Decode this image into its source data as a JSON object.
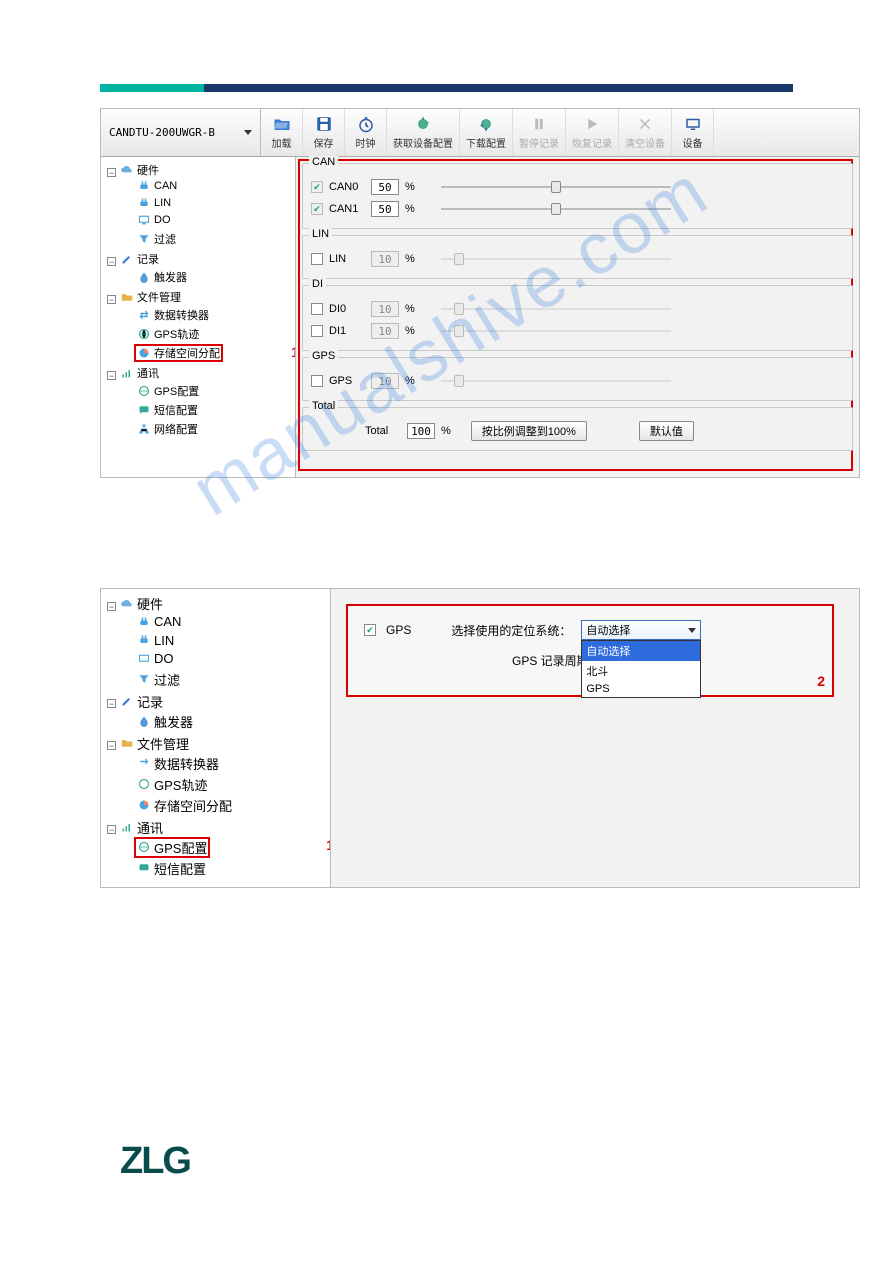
{
  "device_model": "CANDTU-200UWGR-B",
  "toolbar": [
    {
      "label": "加载",
      "icon": "folder-open-icon",
      "disabled": false
    },
    {
      "label": "保存",
      "icon": "save-icon",
      "disabled": false
    },
    {
      "label": "时钟",
      "icon": "clock-icon",
      "disabled": false
    },
    {
      "label": "获取设备配置",
      "icon": "download-config-icon",
      "disabled": false
    },
    {
      "label": "下载配置",
      "icon": "upload-config-icon",
      "disabled": false
    },
    {
      "label": "暂停记录",
      "icon": "pause-icon",
      "disabled": true
    },
    {
      "label": "恢复记录",
      "icon": "play-icon",
      "disabled": true
    },
    {
      "label": "清空设备",
      "icon": "clear-icon",
      "disabled": true
    },
    {
      "label": "设备",
      "icon": "device-icon",
      "disabled": false
    }
  ],
  "tree1": {
    "hardware": {
      "label": "硬件",
      "children": [
        "CAN",
        "LIN",
        "DO",
        "过滤"
      ]
    },
    "record": {
      "label": "记录",
      "children": [
        "触发器"
      ]
    },
    "file_mgmt": {
      "label": "文件管理",
      "children": [
        "数据转换器",
        "GPS轨迹",
        "存储空间分配"
      ]
    },
    "comm": {
      "label": "通讯",
      "children": [
        "GPS配置",
        "短信配置",
        "网络配置"
      ]
    }
  },
  "tree2": {
    "hardware": {
      "label": "硬件",
      "children": [
        "CAN",
        "LIN",
        "DO",
        "过滤"
      ]
    },
    "record": {
      "label": "记录",
      "children": [
        "触发器"
      ]
    },
    "file_mgmt": {
      "label": "文件管理",
      "children": [
        "数据转换器",
        "GPS轨迹",
        "存储空间分配"
      ]
    },
    "comm": {
      "label": "通讯",
      "children": [
        "GPS配置",
        "短信配置"
      ]
    }
  },
  "storage": {
    "groups": {
      "CAN": [
        {
          "name": "CAN0",
          "checked": true,
          "checkbox_disabled": true,
          "value": "50",
          "enabled": true,
          "pos": 50
        },
        {
          "name": "CAN1",
          "checked": true,
          "checkbox_disabled": true,
          "value": "50",
          "enabled": true,
          "pos": 50
        }
      ],
      "LIN": [
        {
          "name": "LIN",
          "checked": false,
          "checkbox_disabled": false,
          "value": "10",
          "enabled": false,
          "pos": 8
        }
      ],
      "DI": [
        {
          "name": "DI0",
          "checked": false,
          "checkbox_disabled": false,
          "value": "10",
          "enabled": false,
          "pos": 8
        },
        {
          "name": "DI1",
          "checked": false,
          "checkbox_disabled": false,
          "value": "10",
          "enabled": false,
          "pos": 8
        }
      ],
      "GPS": [
        {
          "name": "GPS",
          "checked": false,
          "checkbox_disabled": false,
          "value": "10",
          "enabled": false,
          "pos": 8
        }
      ]
    },
    "total": {
      "label": "Total",
      "value": "100",
      "unit": "%",
      "btn_scale": "按比例调整到100%",
      "btn_default": "默认值"
    }
  },
  "gps_config": {
    "enable_label": "GPS",
    "enable_checked": true,
    "system_label": "选择使用的定位系统：",
    "system_selected": "自动选择",
    "system_options": [
      "自动选择",
      "北斗",
      "GPS"
    ],
    "period_label": "GPS 记录周期："
  },
  "annotations": {
    "one": "1",
    "two": "2"
  },
  "watermark": "manualshive.com",
  "footer_logo": "ZLG"
}
